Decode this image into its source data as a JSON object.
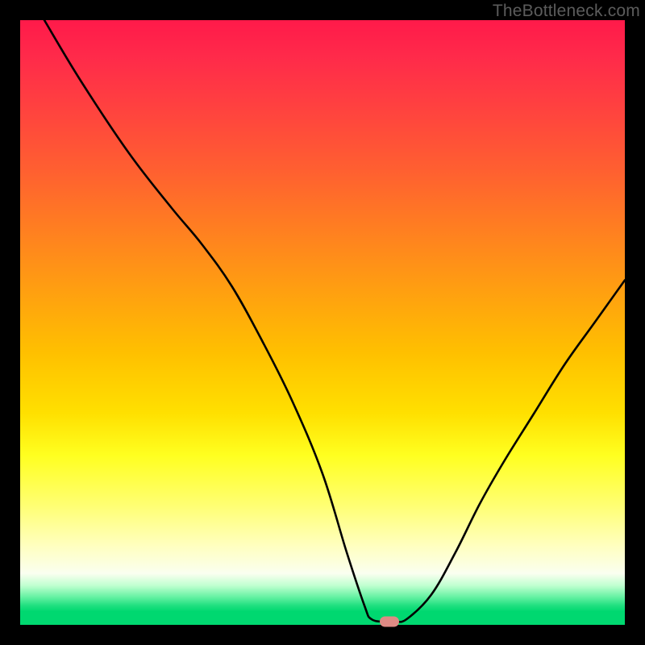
{
  "watermark": "TheBottleneck.com",
  "chart_data": {
    "type": "line",
    "title": "",
    "xlabel": "",
    "ylabel": "",
    "xlim": [
      0,
      100
    ],
    "ylim": [
      0,
      100
    ],
    "grid": false,
    "legend": false,
    "background_gradient": {
      "direction": "top-to-bottom",
      "stops": [
        {
          "pos": 0.0,
          "color": "#ff1a4a"
        },
        {
          "pos": 0.25,
          "color": "#ff6030"
        },
        {
          "pos": 0.55,
          "color": "#ffc000"
        },
        {
          "pos": 0.8,
          "color": "#ffff70"
        },
        {
          "pos": 0.93,
          "color": "#c0ffd0"
        },
        {
          "pos": 1.0,
          "color": "#00d870"
        }
      ]
    },
    "series": [
      {
        "name": "bottleneck-curve",
        "color": "#000000",
        "x": [
          4,
          10,
          18,
          25,
          30,
          35,
          40,
          45,
          50,
          54,
          57,
          58,
          60,
          62,
          64,
          68,
          72,
          76,
          80,
          85,
          90,
          95,
          100
        ],
        "y": [
          100,
          90,
          78,
          69,
          63,
          56,
          47,
          37,
          25,
          12,
          3,
          1,
          0.5,
          0.5,
          1,
          5,
          12,
          20,
          27,
          35,
          43,
          50,
          57
        ]
      }
    ],
    "marker": {
      "name": "optimal-point",
      "x": 61,
      "y": 0.5,
      "color": "#de8a84",
      "shape": "rounded-rect"
    }
  }
}
